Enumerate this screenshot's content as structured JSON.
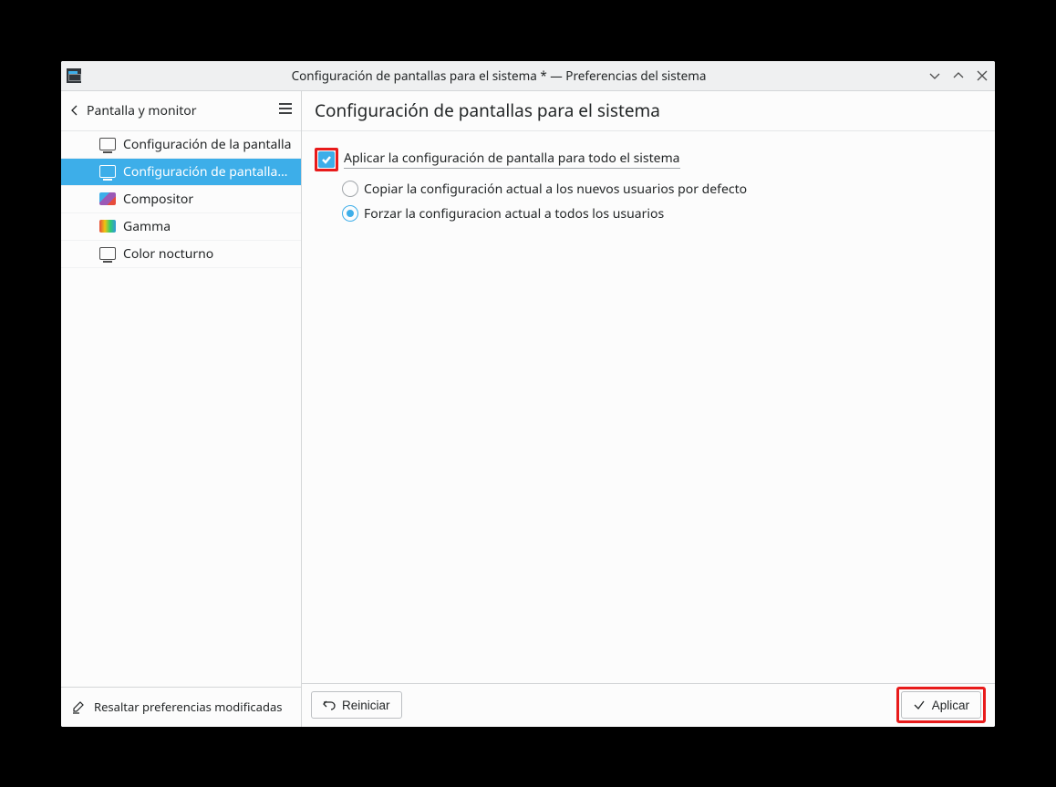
{
  "window": {
    "title": "Configuración de pantallas para el sistema * — Preferencias del sistema"
  },
  "sidebar": {
    "breadcrumb": "Pantalla y monitor",
    "items": [
      {
        "label": "Configuración de la pantalla",
        "icon": "monitor",
        "selected": false
      },
      {
        "label": "Configuración de pantallas p...",
        "icon": "monitor",
        "selected": true
      },
      {
        "label": "Compositor",
        "icon": "compositor",
        "selected": false
      },
      {
        "label": "Gamma",
        "icon": "gamma",
        "selected": false
      },
      {
        "label": "Color nocturno",
        "icon": "monitor",
        "selected": false
      }
    ],
    "footer": "Resaltar preferencias modificadas"
  },
  "main": {
    "title": "Configuración de pantallas para el sistema",
    "checkbox_label": "Aplicar la configuración de pantalla para todo el sistema",
    "checkbox_checked": true,
    "radios": [
      {
        "label": "Copiar la configuración actual a los nuevos usuarios por defecto",
        "checked": false
      },
      {
        "label": "Forzar la configuracion actual a todos los usuarios",
        "checked": true
      }
    ]
  },
  "footer": {
    "reset_label": "Reiniciar",
    "apply_label": "Aplicar"
  }
}
